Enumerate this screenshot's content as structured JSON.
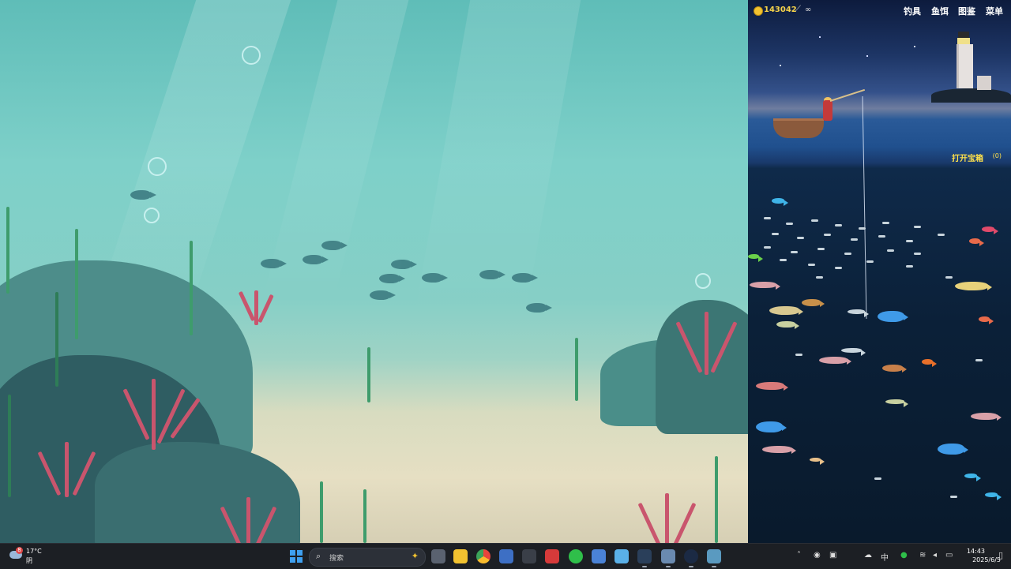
{
  "game": {
    "coins": "143042",
    "rod_uses": "∞",
    "menu": [
      "钓具",
      "鱼饵",
      "图鉴",
      "菜单"
    ],
    "chest_label": "打开宝箱",
    "chest_count": "(0)"
  },
  "taskbar": {
    "weather_badge": "8",
    "temperature": "17°C",
    "condition": "阴",
    "search_placeholder": "搜索",
    "tray_ime": "中",
    "time": "14:43",
    "date": "2025/6/5"
  },
  "colors": {
    "coin": "#f2c230",
    "chest_label": "#ffe14a",
    "taskbar_bg": "#1c1f24"
  }
}
